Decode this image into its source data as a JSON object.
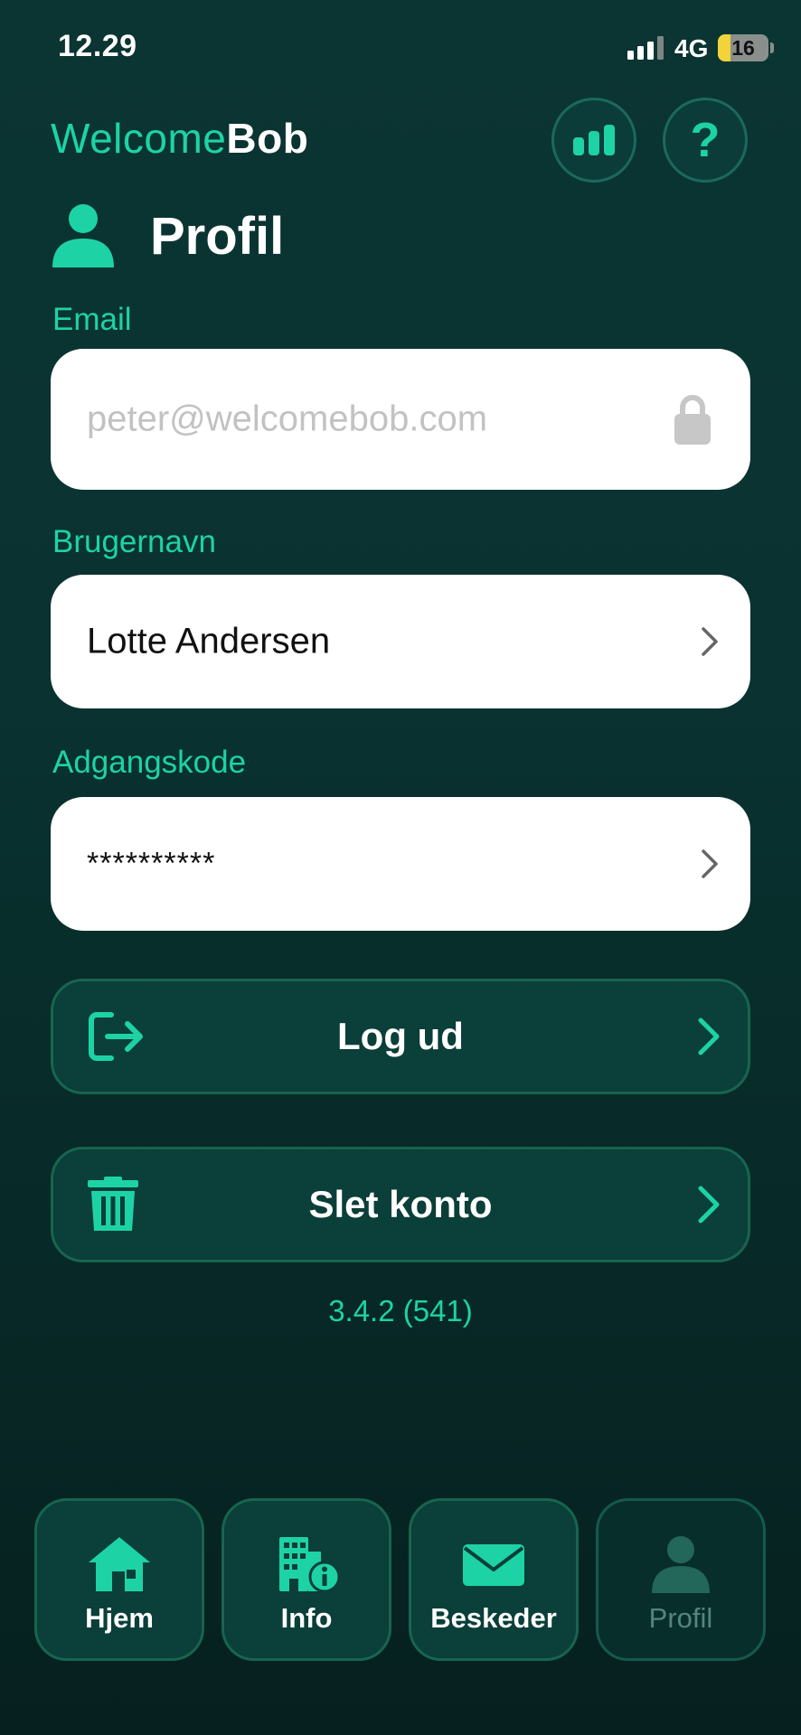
{
  "status_bar": {
    "time": "12.29",
    "network": "4G",
    "battery": "16"
  },
  "header": {
    "logo_part1": "Welcome",
    "logo_part2": "Bob"
  },
  "page": {
    "title": "Profil"
  },
  "fields": {
    "email": {
      "label": "Email",
      "value": "peter@welcomebob.com"
    },
    "username": {
      "label": "Brugernavn",
      "value": "Lotte Andersen"
    },
    "password": {
      "label": "Adgangskode",
      "value": "**********"
    }
  },
  "actions": {
    "logout": {
      "label": "Log ud",
      "icon": "logout-icon"
    },
    "delete": {
      "label": "Slet konto",
      "icon": "trash-icon"
    }
  },
  "version": "3.4.2 (541)",
  "nav": [
    {
      "label": "Hjem",
      "icon": "home-icon"
    },
    {
      "label": "Info",
      "icon": "building-info-icon"
    },
    {
      "label": "Beskeder",
      "icon": "mail-icon"
    },
    {
      "label": "Profil",
      "icon": "user-icon",
      "active": true
    }
  ],
  "colors": {
    "accent": "#1dd3a5",
    "background": "#093230",
    "button_bg": "#0b3f39"
  }
}
